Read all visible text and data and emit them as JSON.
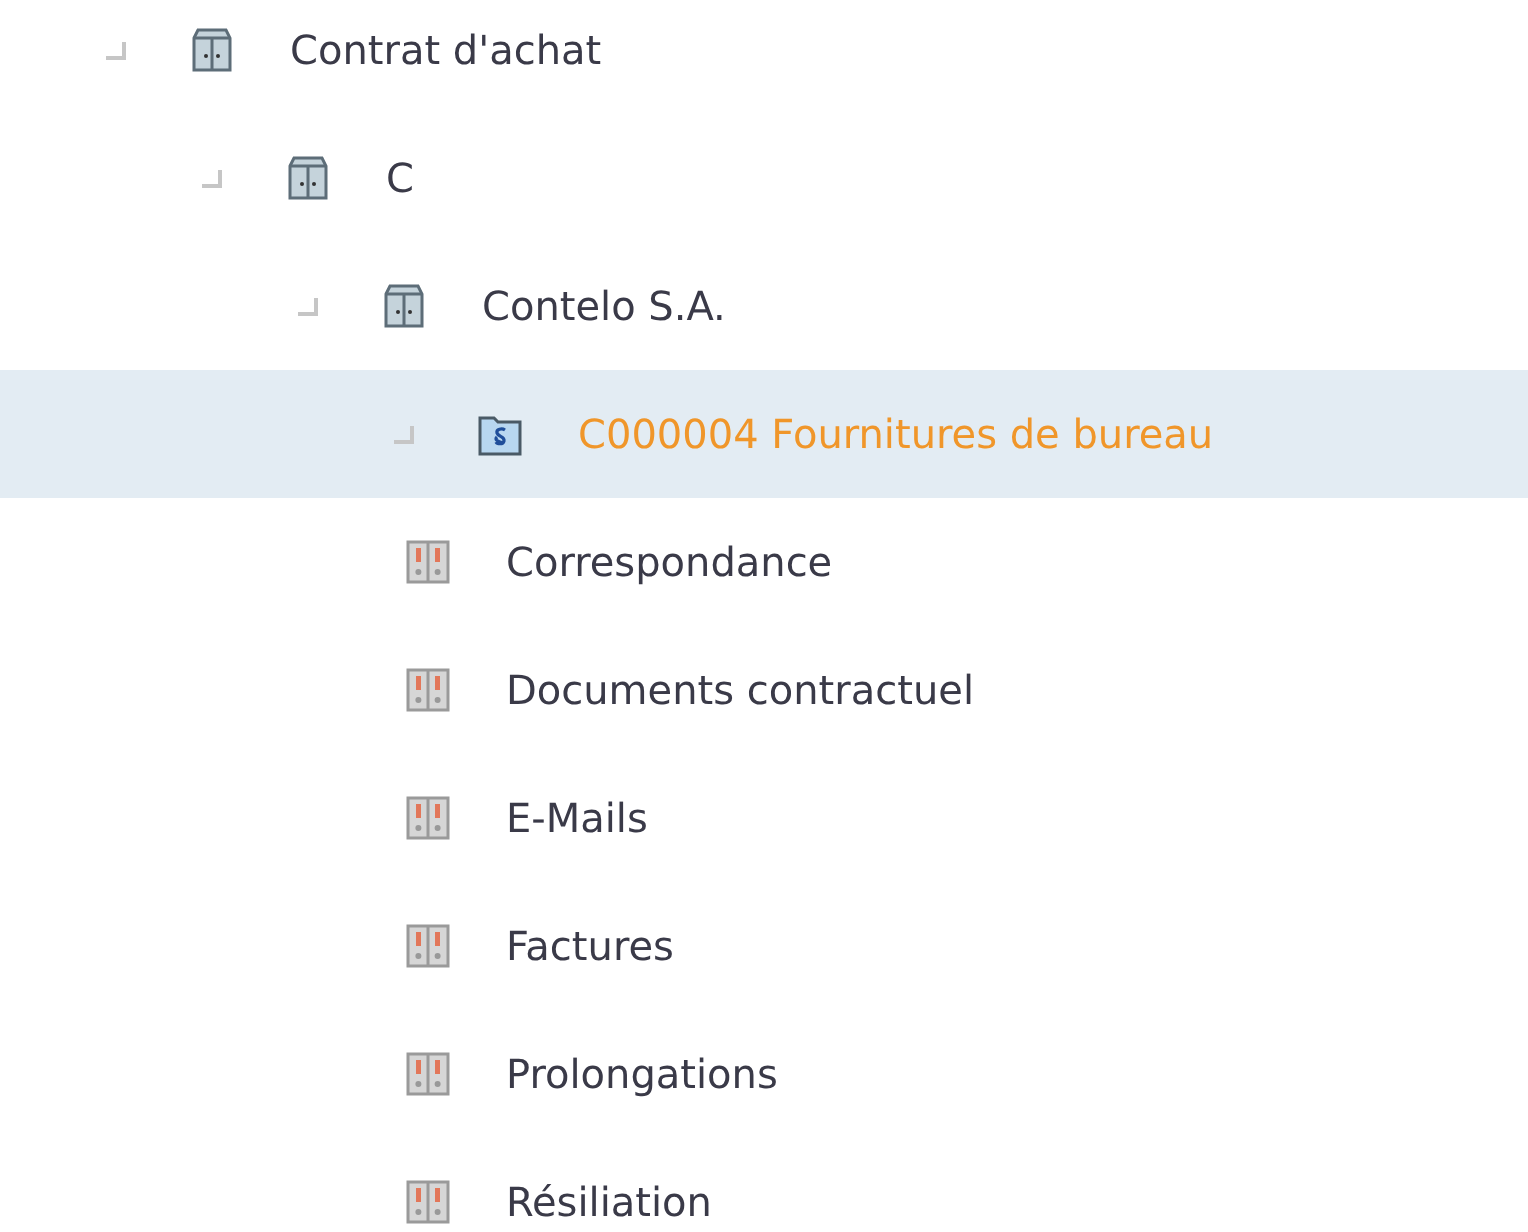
{
  "tree": [
    {
      "label": "Contrat d'achat",
      "kind": "cabinet",
      "selected": false,
      "children": [
        {
          "label": "C",
          "kind": "cabinet",
          "selected": false,
          "children": [
            {
              "label": "Contelo S.A.",
              "kind": "cabinet",
              "selected": false,
              "children": [
                {
                  "label": "C000004 Fournitures de bureau",
                  "kind": "contract",
                  "selected": true,
                  "children": [
                    {
                      "label": "Correspondance",
                      "kind": "binder",
                      "selected": false
                    },
                    {
                      "label": "Documents contractuel",
                      "kind": "binder",
                      "selected": false
                    },
                    {
                      "label": "E-Mails",
                      "kind": "binder",
                      "selected": false
                    },
                    {
                      "label": "Factures",
                      "kind": "binder",
                      "selected": false
                    },
                    {
                      "label": "Prolongations",
                      "kind": "binder",
                      "selected": false
                    },
                    {
                      "label": "Résiliation",
                      "kind": "binder",
                      "selected": false
                    }
                  ]
                }
              ]
            }
          ]
        }
      ]
    }
  ]
}
